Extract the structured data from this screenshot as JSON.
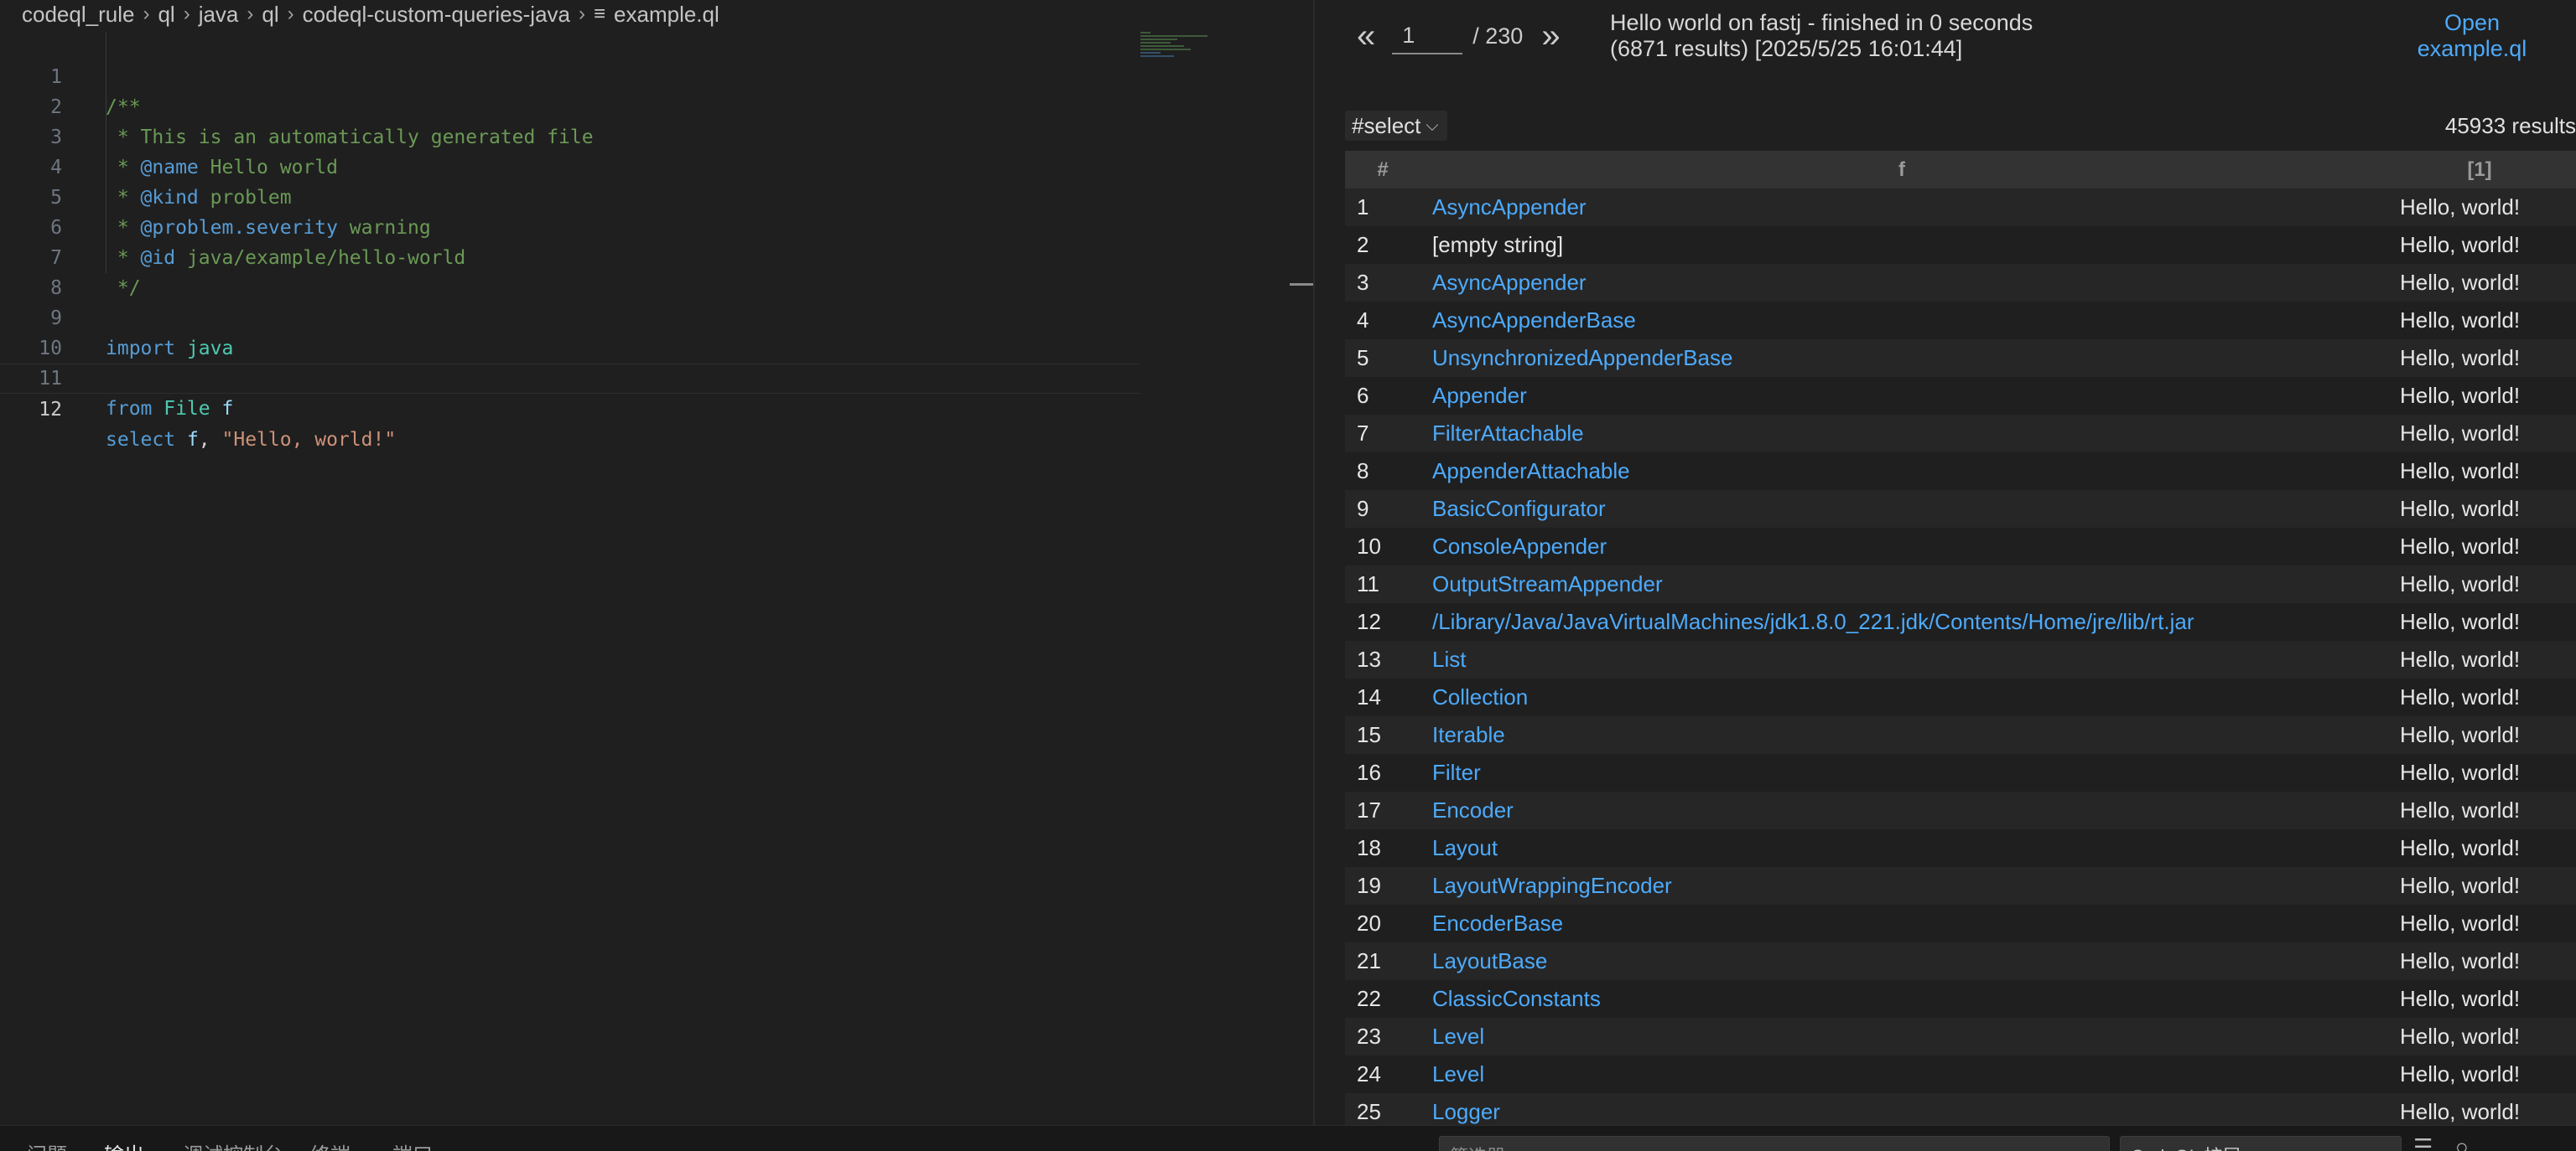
{
  "breadcrumb": {
    "items": [
      "codeql_rule",
      "ql",
      "java",
      "ql",
      "codeql-custom-queries-java"
    ],
    "file": "example.ql"
  },
  "editor": {
    "lines": [
      {
        "n": "1"
      },
      {
        "n": "2"
      },
      {
        "n": "3"
      },
      {
        "n": "4"
      },
      {
        "n": "5"
      },
      {
        "n": "6"
      },
      {
        "n": "7"
      },
      {
        "n": "8"
      },
      {
        "n": "9"
      },
      {
        "n": "10"
      },
      {
        "n": "11"
      },
      {
        "n": "12"
      }
    ],
    "code": {
      "l1": "/**",
      "l2": " * This is an automatically generated file",
      "l3_star": " * ",
      "l3_tag": "@name",
      "l3_rest": " Hello world",
      "l4_star": " * ",
      "l4_tag": "@kind",
      "l4_rest": " problem",
      "l5_star": " * ",
      "l5_tag": "@problem.severity",
      "l5_rest": " warning",
      "l6_star": " * ",
      "l6_tag": "@id",
      "l6_rest": " java/example/hello-world",
      "l7": " */",
      "l9_kw": "import",
      "l9_mod": " java",
      "l11_kw": "from",
      "l11_type": " File",
      "l11_var": " f",
      "l12_kw": "select",
      "l12_var": " f",
      "l12_comma": ", ",
      "l12_str": "\"Hello, world!\""
    }
  },
  "results": {
    "pager": {
      "prev": "«",
      "page": "1",
      "total": "/ 230",
      "next": "»"
    },
    "run_info": "Hello world on fastj - finished in 0 seconds (6871 results) [2025/5/25 16:01:44]",
    "open_link": "Open example.ql",
    "result_set": "#select",
    "count": "45933 results",
    "columns": [
      "#",
      "f",
      "[1]"
    ],
    "rows": [
      {
        "n": "1",
        "f": "AsyncAppender",
        "v": "Hello, world!"
      },
      {
        "n": "2",
        "f": "[empty string]",
        "v": "Hello, world!"
      },
      {
        "n": "3",
        "f": "AsyncAppender",
        "v": "Hello, world!"
      },
      {
        "n": "4",
        "f": "AsyncAppenderBase",
        "v": "Hello, world!"
      },
      {
        "n": "5",
        "f": "UnsynchronizedAppenderBase",
        "v": "Hello, world!"
      },
      {
        "n": "6",
        "f": "Appender",
        "v": "Hello, world!"
      },
      {
        "n": "7",
        "f": "FilterAttachable",
        "v": "Hello, world!"
      },
      {
        "n": "8",
        "f": "AppenderAttachable",
        "v": "Hello, world!"
      },
      {
        "n": "9",
        "f": "BasicConfigurator",
        "v": "Hello, world!"
      },
      {
        "n": "10",
        "f": "ConsoleAppender",
        "v": "Hello, world!"
      },
      {
        "n": "11",
        "f": "OutputStreamAppender",
        "v": "Hello, world!"
      },
      {
        "n": "12",
        "f": "/Library/Java/JavaVirtualMachines/jdk1.8.0_221.jdk/Contents/Home/jre/lib/rt.jar",
        "v": "Hello, world!"
      },
      {
        "n": "13",
        "f": "List",
        "v": "Hello, world!"
      },
      {
        "n": "14",
        "f": "Collection",
        "v": "Hello, world!"
      },
      {
        "n": "15",
        "f": "Iterable",
        "v": "Hello, world!"
      },
      {
        "n": "16",
        "f": "Filter",
        "v": "Hello, world!"
      },
      {
        "n": "17",
        "f": "Encoder",
        "v": "Hello, world!"
      },
      {
        "n": "18",
        "f": "Layout",
        "v": "Hello, world!"
      },
      {
        "n": "19",
        "f": "LayoutWrappingEncoder",
        "v": "Hello, world!"
      },
      {
        "n": "20",
        "f": "EncoderBase",
        "v": "Hello, world!"
      },
      {
        "n": "21",
        "f": "LayoutBase",
        "v": "Hello, world!"
      },
      {
        "n": "22",
        "f": "ClassicConstants",
        "v": "Hello, world!"
      },
      {
        "n": "23",
        "f": "Level",
        "v": "Hello, world!"
      },
      {
        "n": "24",
        "f": "Level",
        "v": "Hello, world!"
      },
      {
        "n": "25",
        "f": "Logger",
        "v": "Hello, world!"
      }
    ]
  },
  "bottom_panel": {
    "tabs": [
      "问题",
      "输出",
      "调试控制台",
      "终端",
      "端口"
    ],
    "filter_placeholder": "筛选器",
    "channel": "CodeQL 扩展"
  },
  "icons": {
    "file": "menu-lines-icon",
    "chevron": "chevron-right-icon",
    "dropdown": "chevron-down-icon"
  }
}
